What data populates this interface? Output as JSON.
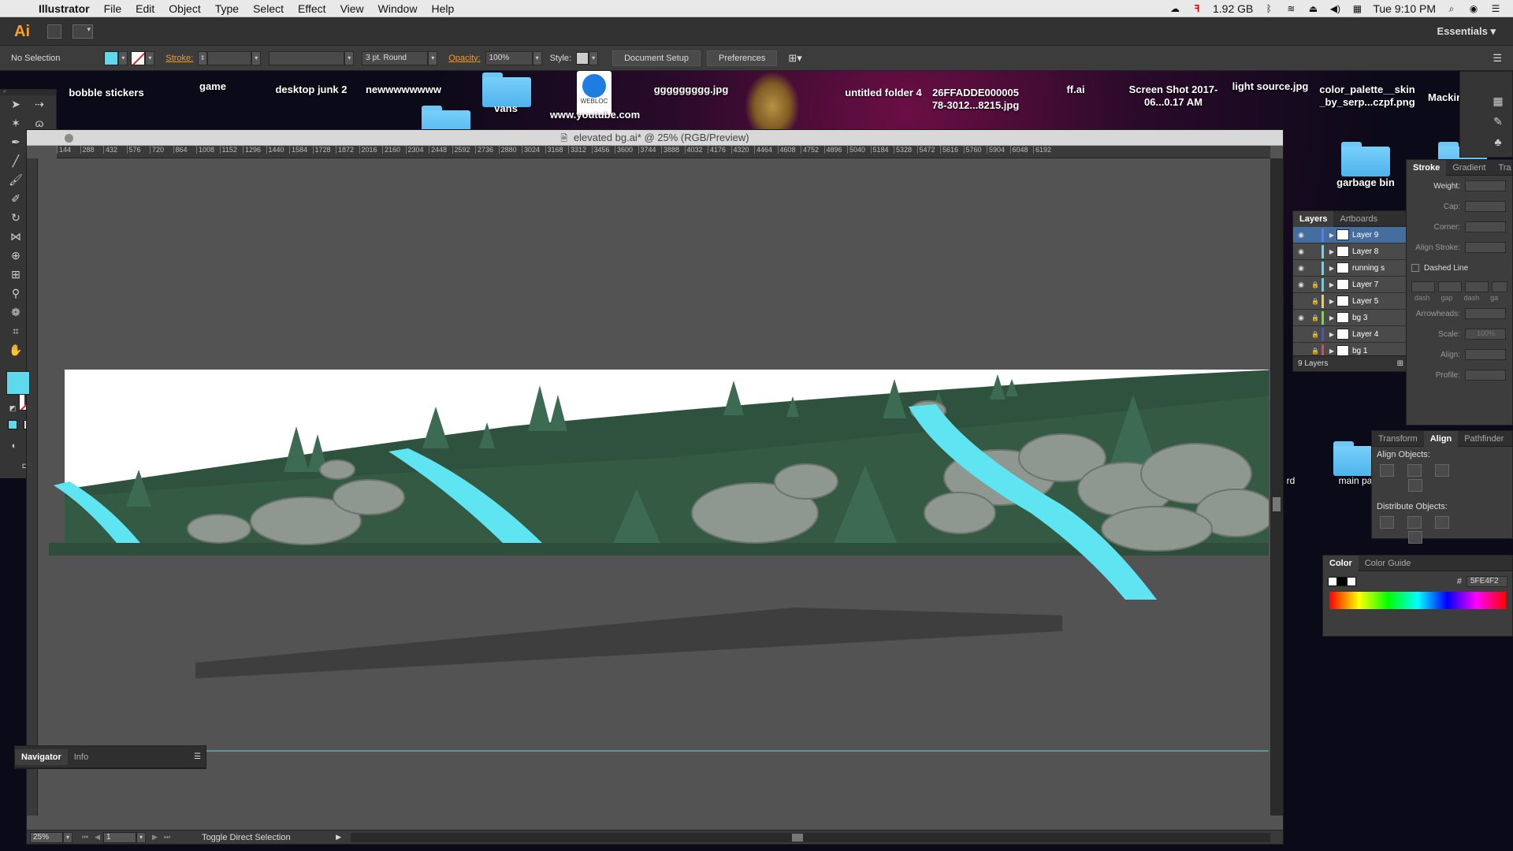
{
  "menubar": {
    "app": "Illustrator",
    "items": [
      "File",
      "Edit",
      "Object",
      "Type",
      "Select",
      "Effect",
      "View",
      "Window",
      "Help"
    ],
    "memory": "1.92 GB",
    "clock": "Tue 9:10 PM"
  },
  "desktop": {
    "items": [
      "bobble stickers",
      "game",
      "desktop junk 2",
      "newwwwwwww",
      "vans",
      "www.youtube.com",
      "ggggggggg.jpg",
      "untitled folder 4",
      "26FFADDE000005 78-3012...8215.jpg",
      "ff.ai",
      "Screen Shot 2017-06...0.17 AM",
      "light source.jpg",
      "color_palette__skin _by_serp...czpf.png",
      "Mackintos",
      "garbage bin",
      "main pa",
      "rd"
    ],
    "webloc_label": "WEBLOC"
  },
  "appbar": {
    "logo": "Ai",
    "workspace": "Essentials"
  },
  "control": {
    "selection": "No Selection",
    "stroke_label": "Stroke:",
    "brush": "3 pt. Round",
    "opacity_label": "Opacity:",
    "opacity_value": "100%",
    "style_label": "Style:",
    "doc_setup": "Document Setup",
    "preferences": "Preferences"
  },
  "document": {
    "title": "elevated bg.ai* @ 25% (RGB/Preview)",
    "ruler_ticks": [
      "144",
      "288",
      "432",
      "576",
      "720",
      "864",
      "1008",
      "1152",
      "1296",
      "1440",
      "1584",
      "1728",
      "1872",
      "2016",
      "2160",
      "2304",
      "2448",
      "2592",
      "2736",
      "2880",
      "3024",
      "3168",
      "3312",
      "3456",
      "3600",
      "3744",
      "3888",
      "4032",
      "4176",
      "4320",
      "4464",
      "4608",
      "4752",
      "4896",
      "5040",
      "5184",
      "5328",
      "5472",
      "5616",
      "5760",
      "5904",
      "6048",
      "6192"
    ],
    "zoom": "25%",
    "artboard": "1",
    "status": "Toggle Direct Selection"
  },
  "stroke_panel": {
    "tabs": [
      "Stroke",
      "Gradient",
      "Tra"
    ],
    "weight": "Weight:",
    "cap": "Cap:",
    "corner": "Corner:",
    "align_stroke": "Align Stroke:",
    "dashed": "Dashed Line",
    "dash_labels": [
      "dash",
      "gap",
      "dash",
      "ga"
    ],
    "arrowheads": "Arrowheads:",
    "scale": "Scale:",
    "scale_value": "100%",
    "align": "Align:",
    "profile": "Profile:"
  },
  "layers_panel": {
    "tabs": [
      "Layers",
      "Artboards"
    ],
    "layers": [
      {
        "name": "Layer 9",
        "color": "#4f7fff",
        "eye": true,
        "lock": false,
        "selected": true
      },
      {
        "name": "Layer 8",
        "color": "#5fd9ec",
        "eye": true,
        "lock": false,
        "selected": false
      },
      {
        "name": "running s",
        "color": "#5fd9ec",
        "eye": true,
        "lock": false,
        "selected": false
      },
      {
        "name": "Layer 7",
        "color": "#55d6ee",
        "eye": true,
        "lock": true,
        "selected": false
      },
      {
        "name": "Layer 5",
        "color": "#e8d34a",
        "eye": false,
        "lock": true,
        "selected": false
      },
      {
        "name": "bg 3",
        "color": "#7adc3a",
        "eye": true,
        "lock": true,
        "selected": false
      },
      {
        "name": "Layer 4",
        "color": "#4a4fd8",
        "eye": false,
        "lock": true,
        "selected": false
      },
      {
        "name": "bg 1",
        "color": "#d84a4a",
        "eye": false,
        "lock": true,
        "selected": false
      }
    ],
    "count": "9 Layers"
  },
  "align_panel": {
    "tabs": [
      "Transform",
      "Align",
      "Pathfinder"
    ],
    "align_objects": "Align Objects:",
    "distribute_objects": "Distribute Objects:"
  },
  "color_panel": {
    "tabs": [
      "Color",
      "Color Guide"
    ],
    "hash": "#",
    "hex": "5FE4F2"
  },
  "navigator_panel": {
    "tabs": [
      "Navigator",
      "Info"
    ]
  },
  "colors": {
    "fill": "#5fd9ec",
    "hill_dark": "#2e4d3a",
    "hill": "#355a43",
    "rock": "#8e9890",
    "water": "#5fe4f2"
  }
}
